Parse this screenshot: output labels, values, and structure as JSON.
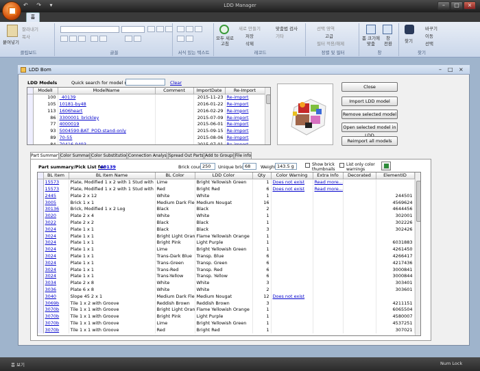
{
  "window": {
    "title": "LDD Manager"
  },
  "ribbon": {
    "home_tab": "홈",
    "groups": {
      "clipboard": {
        "label": "클립보드",
        "paste": "붙여넣기",
        "cut": "잘라내기",
        "copy": "복사"
      },
      "font": {
        "label": "글꼴"
      },
      "rich_text": {
        "label": "서식 있는 텍스트"
      },
      "records": {
        "label": "레코드",
        "refresh_all": "모두 새로\n고침",
        "new": "새로 만들기",
        "save": "저장",
        "delete": "삭제",
        "spelling": "맞춤법 검사",
        "more": "기타"
      },
      "sort_filter": {
        "label": "정렬 및 필터",
        "selection": "선택 영역",
        "advanced": "고급",
        "toggle_filter": "필터 적용/해제"
      },
      "window": {
        "label": "창",
        "fit_form": "폼 크기에\n맞춤",
        "switch_windows": "창\n전환"
      },
      "find": {
        "label": "찾기",
        "find": "찾기",
        "replace": "바꾸기",
        "goto": "이동",
        "select": "선택"
      }
    }
  },
  "form": {
    "title": "LDD Bom",
    "models_label": "LDD Models",
    "quick_search_label": "Quick search for model name",
    "quick_search_value": "",
    "clear": "Clear",
    "columns": [
      "ModelI",
      "ModelName",
      "Comment",
      "ImportDate",
      "Re-Import"
    ],
    "models": [
      {
        "id": "100",
        "name": "_40139",
        "comment": "",
        "date": "2015-11-23",
        "action": "Re-import"
      },
      {
        "id": "105",
        "name": "10181-by48",
        "comment": "",
        "date": "2016-01-22",
        "action": "Re-import"
      },
      {
        "id": "113",
        "name": "1606heart",
        "comment": "",
        "date": "2016-02-29",
        "action": "Re-import"
      },
      {
        "id": "86",
        "name": "3300001_brickley",
        "comment": "",
        "date": "2015-07-09",
        "action": "Re-import"
      },
      {
        "id": "77",
        "name": "4000019",
        "comment": "",
        "date": "2015-06-01",
        "action": "Re-import"
      },
      {
        "id": "93",
        "name": "5004590-BAT_POD-stand-only",
        "comment": "",
        "date": "2015-09-15",
        "action": "Re-import"
      },
      {
        "id": "89",
        "name": "70-55",
        "comment": "",
        "date": "2015-08-06",
        "action": "Re-import"
      },
      {
        "id": "84",
        "name": "70416-9493",
        "comment": "",
        "date": "2015-07-01",
        "action": "Re-import"
      }
    ],
    "buttons": {
      "close": "Close",
      "import": "Import LDD model",
      "remove": "Remove selected model",
      "open": "Open selected model in LDD",
      "reimport": "Reimport all models"
    },
    "tabs": [
      "Part Summary",
      "Color Summary",
      "Color Substitution",
      "Connection Analysis",
      "Spread Out Parts",
      "Add to Groups",
      "File info"
    ],
    "summary": {
      "heading": "Part summary/Pick List for",
      "model": "_40139",
      "brick_count_label": "Brick count",
      "brick_count": "250",
      "unique_label": "Unique bricks",
      "unique": "68",
      "weight_label": "Weight",
      "weight": "143.5 g",
      "show_thumbs": "Show brick thumbnails",
      "only_color_warnings": "List only color warnings"
    },
    "part_columns": [
      "BL Item",
      "BL Item Name",
      "BL Color",
      "LDD Color",
      "Qty",
      "Color Warning",
      "Extra Info",
      "Decorated",
      "ElementID"
    ],
    "parts": [
      {
        "item": "15573",
        "name": "Plate, Modified 1 x 2 with 1 Stud with C",
        "bl_color": "Lime",
        "ldd_color": "Bright Yellowish Green",
        "qty": "1",
        "warn": "Does not exist",
        "extra": "Read more...",
        "dec": "",
        "eid": ""
      },
      {
        "item": "15573",
        "name": "Plate, Modified 1 x 2 with 1 Stud with C",
        "bl_color": "Red",
        "ldd_color": "Bright Red",
        "qty": "6",
        "warn": "Does not exist",
        "extra": "Read more...",
        "dec": "",
        "eid": ""
      },
      {
        "item": "2445",
        "name": "Plate 2 x 12",
        "bl_color": "White",
        "ldd_color": "White",
        "qty": "1",
        "warn": "",
        "extra": "",
        "dec": "",
        "eid": "244501"
      },
      {
        "item": "3005",
        "name": "Brick 1 x 1",
        "bl_color": "Medium Dark Fle:",
        "ldd_color": "Medium Nougat",
        "qty": "16",
        "warn": "",
        "extra": "",
        "dec": "",
        "eid": "4569624"
      },
      {
        "item": "30136",
        "name": "Brick, Modified 1 x 2 Log",
        "bl_color": "Black",
        "ldd_color": "Black",
        "qty": "2",
        "warn": "",
        "extra": "",
        "dec": "",
        "eid": "4644456"
      },
      {
        "item": "3020",
        "name": "Plate 2 x 4",
        "bl_color": "White",
        "ldd_color": "White",
        "qty": "1",
        "warn": "",
        "extra": "",
        "dec": "",
        "eid": "302001"
      },
      {
        "item": "3022",
        "name": "Plate 2 x 2",
        "bl_color": "Black",
        "ldd_color": "Black",
        "qty": "1",
        "warn": "",
        "extra": "",
        "dec": "",
        "eid": "302226"
      },
      {
        "item": "3024",
        "name": "Plate 1 x 1",
        "bl_color": "Black",
        "ldd_color": "Black",
        "qty": "3",
        "warn": "",
        "extra": "",
        "dec": "",
        "eid": "302426"
      },
      {
        "item": "3024",
        "name": "Plate 1 x 1",
        "bl_color": "Bright Light Orang",
        "ldd_color": "Flame Yellowish Orange",
        "qty": "1",
        "warn": "",
        "extra": "",
        "dec": "",
        "eid": ""
      },
      {
        "item": "3024",
        "name": "Plate 1 x 1",
        "bl_color": "Bright Pink",
        "ldd_color": "Light Purple",
        "qty": "1",
        "warn": "",
        "extra": "",
        "dec": "",
        "eid": "6031883"
      },
      {
        "item": "3024",
        "name": "Plate 1 x 1",
        "bl_color": "Lime",
        "ldd_color": "Bright Yellowish Green",
        "qty": "1",
        "warn": "",
        "extra": "",
        "dec": "",
        "eid": "4261450"
      },
      {
        "item": "3024",
        "name": "Plate 1 x 1",
        "bl_color": "Trans-Dark Blue",
        "ldd_color": "Transp. Blue",
        "qty": "6",
        "warn": "",
        "extra": "",
        "dec": "",
        "eid": "4266417"
      },
      {
        "item": "3024",
        "name": "Plate 1 x 1",
        "bl_color": "Trans-Green",
        "ldd_color": "Transp. Green",
        "qty": "6",
        "warn": "",
        "extra": "",
        "dec": "",
        "eid": "4217436"
      },
      {
        "item": "3024",
        "name": "Plate 1 x 1",
        "bl_color": "Trans-Red",
        "ldd_color": "Transp. Red",
        "qty": "6",
        "warn": "",
        "extra": "",
        "dec": "",
        "eid": "3000841"
      },
      {
        "item": "3024",
        "name": "Plate 1 x 1",
        "bl_color": "Trans-Yellow",
        "ldd_color": "Transp. Yellow",
        "qty": "6",
        "warn": "",
        "extra": "",
        "dec": "",
        "eid": "3000844"
      },
      {
        "item": "3034",
        "name": "Plate 2 x 8",
        "bl_color": "White",
        "ldd_color": "White",
        "qty": "3",
        "warn": "",
        "extra": "",
        "dec": "",
        "eid": "303401"
      },
      {
        "item": "3036",
        "name": "Plate 6 x 8",
        "bl_color": "White",
        "ldd_color": "White",
        "qty": "2",
        "warn": "",
        "extra": "",
        "dec": "",
        "eid": "303601"
      },
      {
        "item": "3040",
        "name": "Slope 45 2 x 1",
        "bl_color": "Medium Dark Fle:",
        "ldd_color": "Medium Nougat",
        "qty": "12",
        "warn": "Does not exist",
        "extra": "",
        "dec": "",
        "eid": ""
      },
      {
        "item": "3069b",
        "name": "Tile 1 x 2 with Groove",
        "bl_color": "Reddish Brown",
        "ldd_color": "Reddish Brown",
        "qty": "3",
        "warn": "",
        "extra": "",
        "dec": "",
        "eid": "4211151"
      },
      {
        "item": "3070b",
        "name": "Tile 1 x 1 with Groove",
        "bl_color": "Bright Light Orang",
        "ldd_color": "Flame Yellowish Orange",
        "qty": "1",
        "warn": "",
        "extra": "",
        "dec": "",
        "eid": "6065504"
      },
      {
        "item": "3070b",
        "name": "Tile 1 x 1 with Groove",
        "bl_color": "Bright Pink",
        "ldd_color": "Light Purple",
        "qty": "1",
        "warn": "",
        "extra": "",
        "dec": "",
        "eid": "4580007"
      },
      {
        "item": "3070b",
        "name": "Tile 1 x 1 with Groove",
        "bl_color": "Lime",
        "ldd_color": "Bright Yellowish Green",
        "qty": "1",
        "warn": "",
        "extra": "",
        "dec": "",
        "eid": "4537251"
      },
      {
        "item": "3070b",
        "name": "Tile 1 x 1 with Groove",
        "bl_color": "Red",
        "ldd_color": "Bright Red",
        "qty": "1",
        "warn": "",
        "extra": "",
        "dec": "",
        "eid": "307021"
      }
    ]
  },
  "status": {
    "left": "폼 보기",
    "right": "Num Lock"
  }
}
